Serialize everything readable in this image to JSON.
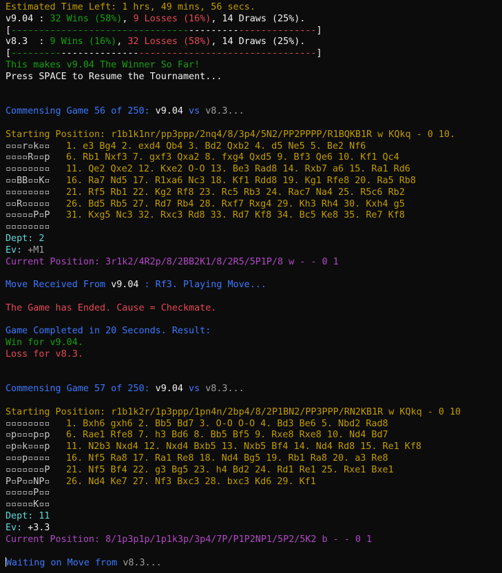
{
  "header": {
    "eta": "Estimated Time Left: 1 hrs, 49 mins, 56 secs.",
    "v904_name": "v9.04",
    "v904_sep": " : ",
    "v904_wins": "32 Wins (58%)",
    "v904_losses": "9 Losses (16%)",
    "v904_draws": ", 14 Draws (25%).",
    "bar1_open": "[",
    "bar1_green": "--------------------------------",
    "bar1_white": "---------",
    "bar1_red": "--------------",
    "bar1_close": "]",
    "v83_name": "v8.3 ",
    "v83_sep": " : ",
    "v83_wins": "9 Wins (16%)",
    "v83_losses": "32 Losses (58%)",
    "v83_draws": ", 14 Draws (25%).",
    "bar2_open": "[",
    "bar2_green": "---------",
    "bar2_white": "--------------",
    "bar2_red": "--------------------------------",
    "bar2_close": "]",
    "winner_line": "This makes v9.04 The Winner So Far!",
    "press_line": "Press SPACE to Resume the Tournament..."
  },
  "game1": {
    "commensing_prefix": "Commensing Game 56 of 250: ",
    "white_engine": "v9.04",
    "vs": " vs ",
    "black_engine": "v8.3...",
    "starting_label": "Starting Position: ",
    "starting_fen": "r1b1k1nr/pp3ppp/2nq4/8/3p4/5N2/PP2PPPP/R1BQKB1R w KQkq - 0 10.",
    "board": [
      "▫▫▫r▫k▫▫",
      "▫▫▫▫R▫▫p",
      "▫▫▫▫▫▫▫▫",
      "▫▫BB▫▫K▫",
      "▫▫▫▫▫▫▫▫",
      "▫▫R▫▫▫▫▫",
      "▫▫▫▫▫P▫P",
      "▫▫▫▫▫▫▫▫"
    ],
    "moves": [
      "1. e3 Bg4 2. exd4 Qb4 3. Bd2 Qxb2 4. d5 Ne5 5. Be2 Nf6",
      "6. Rb1 Nxf3 7. gxf3 Qxa2 8. fxg4 Qxd5 9. Bf3 Qe6 10. Kf1 Qc4",
      "11. Qe2 Qxe2 12. Kxe2 O-O 13. Be3 Rad8 14. Rxb7 a6 15. Ra1 Rd6",
      "16. Ra7 Nd5 17. R1xa6 Nc3 18. Kf1 Rdd8 19. Kg1 Rfe8 20. Ra5 Rb8",
      "21. Rf5 Rb1 22. Kg2 Rf8 23. Rc5 Rb3 24. Rac7 Na4 25. R5c6 Rb2",
      "26. Bd5 Rb5 27. Rd7 Rb4 28. Rxf7 Rxg4 29. Kh3 Rh4 30. Kxh4 g5",
      "31. Kxg5 Nc3 32. Rxc3 Rd8 33. Rd7 Kf8 34. Bc5 Ke8 35. Re7 Kf8"
    ],
    "dept_label": "Dept: 2",
    "ev_label": "Ev: ",
    "ev_value": "+M1",
    "current_position": "Current Position: 3r1k2/4R2p/8/2BB2K1/8/2R5/5P1P/8 w - - 0 1",
    "move_received_prefix": "Move Received From ",
    "move_received_engine": "v9.04",
    "move_received_suffix": " : Rf3. Playing Move...",
    "game_ended": "The Game has Ended. Cause = Checkmate.",
    "completed": "Game Completed in 20 Seconds. Result:",
    "win_line": "Win for v9.04.",
    "loss_line": "Loss for v8.3."
  },
  "game2": {
    "commensing_prefix": "Commensing Game 57 of 250: ",
    "white_engine": "v9.04",
    "vs": " vs ",
    "black_engine": "v8.3...",
    "starting_label": "Starting Position: ",
    "starting_fen": "r1b1k2r/1p3ppp/1pn4n/2bp4/8/2P1BN2/PP3PPP/RN2KB1R w KQkq - 0 10",
    "board": [
      "▫▫▫▫▫▫▫▫",
      "▫p▫▫▫p▫p",
      "▫p▫k▫▫▫p",
      "▫▫▫p▫▫▫▫",
      "▫▫▫▫▫▫▫P",
      "P▫P▫▫NP▫",
      "▫▫▫▫▫P▫▫",
      "▫▫▫▫▫K▫▫"
    ],
    "moves": [
      "1. Bxh6 gxh6 2. Bb5 Bd7 3. O-O O-O 4. Bd3 Be6 5. Nbd2 Rad8",
      "6. Rae1 Rfe8 7. h3 Bd6 8. Bb5 Bf5 9. Rxe8 Rxe8 10. Nd4 Bd7",
      "11. N2b3 Nxd4 12. Nxd4 Bxb5 13. Nxb5 Bf4 14. Nd4 Rd8 15. Re1 Kf8",
      "16. Nf5 Ra8 17. Ra1 Re8 18. Nd4 Bg5 19. Rb1 Ra8 20. a3 Re8",
      "21. Nf5 Bf4 22. g3 Bg5 23. h4 Bd2 24. Rd1 Re1 25. Rxe1 Bxe1",
      "26. Nd4 Ke7 27. Nf3 Bxc3 28. bxc3 Kd6 29. Kf1",
      ""
    ],
    "dept_label": "Dept: 11",
    "ev_label": "Ev: ",
    "ev_value": "+3.3",
    "current_position": "Current Position: 8/1p3p1p/1p1k3p/3p4/7P/P1P2NP1/5P2/5K2 b - - 0 1",
    "waiting_prefix": "Waiting on Move from ",
    "waiting_engine": "v8.3..."
  }
}
